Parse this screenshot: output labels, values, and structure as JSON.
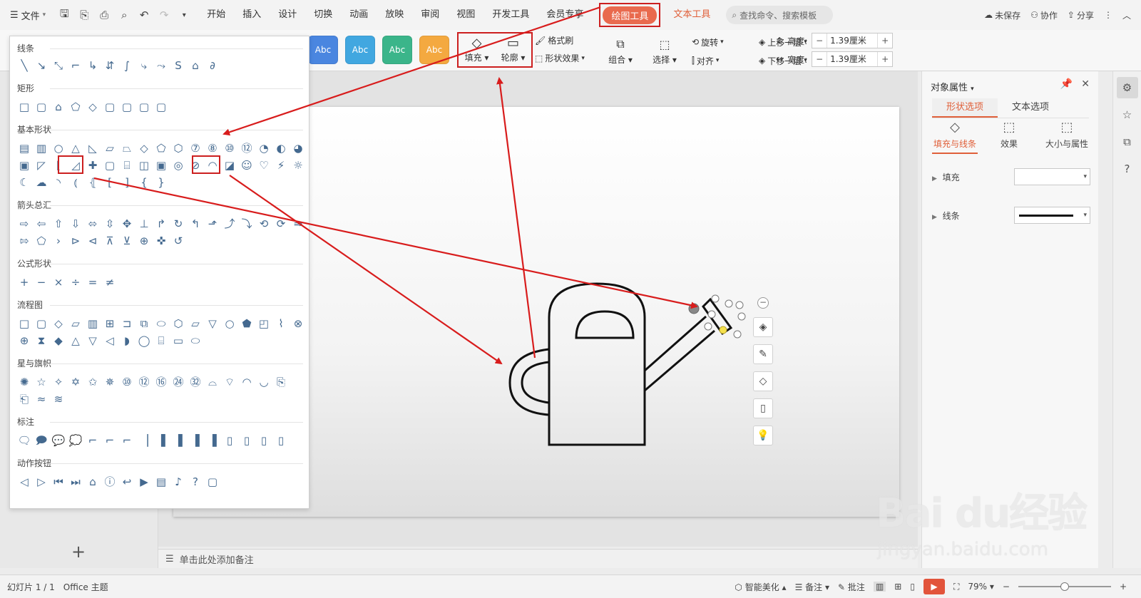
{
  "menubar": {
    "file_label": "文件",
    "tabs": [
      "开始",
      "插入",
      "设计",
      "切换",
      "动画",
      "放映",
      "审阅",
      "视图",
      "开发工具",
      "会员专享"
    ],
    "drawing_tool": "绘图工具",
    "text_tool": "文本工具",
    "search_placeholder": "查找命令、搜索模板",
    "unsaved": "未保存",
    "collab": "协作",
    "share": "分享"
  },
  "ribbon": {
    "style_label": "Abc",
    "style_colors": [
      "#4a86e0",
      "#41a7e0",
      "#3bb58a",
      "#f4a940"
    ],
    "fill": "填充",
    "outline": "轮廓",
    "format_brush": "格式刷",
    "shape_effect": "形状效果",
    "rotate": "旋转",
    "bring_forward": "上移一层",
    "group": "组合",
    "align": "对齐",
    "send_backward": "下移一层",
    "select": "选择",
    "height_label": "高度:",
    "height_value": "1.39厘米",
    "width_label": "宽度:",
    "width_value": "1.39厘米"
  },
  "gallery": {
    "sections": [
      "线条",
      "矩形",
      "基本形状",
      "箭头总汇",
      "公式形状",
      "流程图",
      "星与旗帜",
      "标注",
      "动作按钮"
    ]
  },
  "workspace": {
    "notes_placeholder": "单击此处添加备注"
  },
  "props": {
    "title": "对象属性",
    "tab_shape": "形状选项",
    "tab_text": "文本选项",
    "sub_fill_line": "填充与线条",
    "sub_effect": "效果",
    "sub_size": "大小与属性",
    "fill_label": "填充",
    "line_label": "线条"
  },
  "status": {
    "slide_counter": "幻灯片 1 / 1",
    "theme": "Office 主题",
    "beautify": "智能美化",
    "notes": "备注",
    "comment": "批注",
    "zoom": "79%",
    "zoom_level": 0.5
  },
  "watermark": {
    "logo": "Bai du经验",
    "url": "jingyan.baidu.com"
  },
  "colors": {
    "accent": "#e0603a",
    "highlight_red": "#cc1f1f",
    "icon_blue": "#44698f"
  }
}
